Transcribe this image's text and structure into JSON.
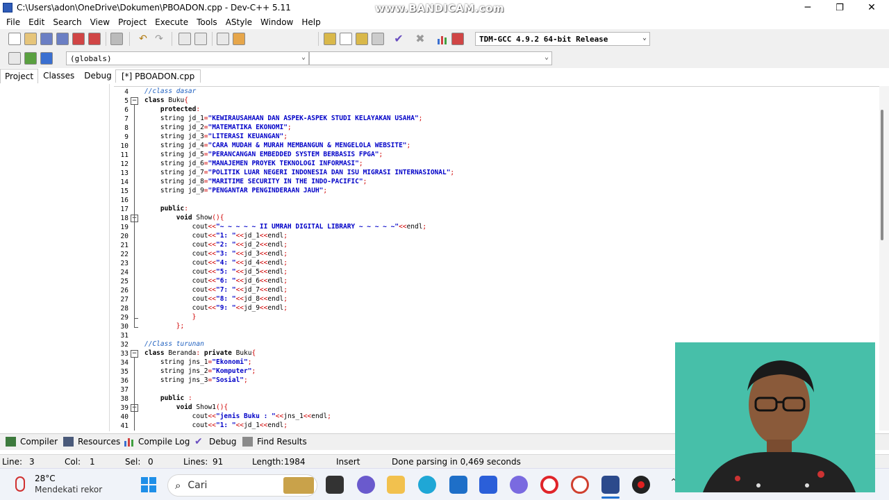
{
  "window": {
    "title": "C:\\Users\\adon\\OneDrive\\Dokumen\\PBOADON.cpp - Dev-C++ 5.11",
    "watermark": "www.BANDICAM.com",
    "min": "─",
    "max": "❐",
    "close": "✕"
  },
  "menu": [
    "File",
    "Edit",
    "Search",
    "View",
    "Project",
    "Execute",
    "Tools",
    "AStyle",
    "Window",
    "Help"
  ],
  "toolbar": {
    "compiler_select": "TDM-GCC 4.9.2 64-bit Release",
    "scope_select": "(globals)",
    "member_select": ""
  },
  "side_tabs": [
    "Project",
    "Classes",
    "Debug"
  ],
  "editor_tab": "[*] PBOADON.cpp",
  "code_lines": [
    {
      "n": "4",
      "html": "<span class='cm'>//class dasar</span>"
    },
    {
      "n": "5",
      "html": "<span class='kw'>class</span> Buku<span class='op'>{</span>",
      "fold": "open"
    },
    {
      "n": "6",
      "html": "    <span class='kw'>protected</span><span class='op'>:</span>"
    },
    {
      "n": "7",
      "html": "    string jd_1<span class='op'>=</span><span class='str'>\"KEWIRAUSAHAAN DAN ASPEK-ASPEK STUDI KELAYAKAN USAHA\"</span><span class='op'>;</span>"
    },
    {
      "n": "8",
      "html": "    string jd_2<span class='op'>=</span><span class='str'>\"MATEMATIKA EKONOMI\"</span><span class='op'>;</span>"
    },
    {
      "n": "9",
      "html": "    string jd_3<span class='op'>=</span><span class='str'>\"LITERASI KEUANGAN\"</span><span class='op'>;</span>"
    },
    {
      "n": "10",
      "html": "    string jd_4<span class='op'>=</span><span class='str'>\"CARA MUDAH &amp; MURAH MEMBANGUN &amp; MENGELOLA WEBSITE\"</span><span class='op'>;</span>"
    },
    {
      "n": "11",
      "html": "    string jd_5<span class='op'>=</span><span class='str'>\"PERANCANGAN EMBEDDED SYSTEM BERBASIS FPGA\"</span><span class='op'>;</span>"
    },
    {
      "n": "12",
      "html": "    string jd_6<span class='op'>=</span><span class='str'>\"MANAJEMEN PROYEK TEKNOLOGI INFORMASI\"</span><span class='op'>;</span>"
    },
    {
      "n": "13",
      "html": "    string jd_7<span class='op'>=</span><span class='str'>\"POLITIK LUAR NEGERI INDONESIA DAN ISU MIGRASI INTERNASIONAL\"</span><span class='op'>;</span>"
    },
    {
      "n": "14",
      "html": "    string jd_8<span class='op'>=</span><span class='str'>\"MARITIME SECURITY IN THE INDO-PACIFIC\"</span><span class='op'>;</span>"
    },
    {
      "n": "15",
      "html": "    string jd_9<span class='op'>=</span><span class='str'>\"PENGANTAR PENGINDERAAN JAUH\"</span><span class='op'>;</span>"
    },
    {
      "n": "16",
      "html": ""
    },
    {
      "n": "17",
      "html": "    <span class='kw'>public</span><span class='op'>:</span>"
    },
    {
      "n": "18",
      "html": "        <span class='kw'>void</span> Show<span class='op'>(){</span>",
      "fold": "open"
    },
    {
      "n": "19",
      "html": "            cout<span class='op'>&lt;&lt;</span><span class='str'>\"~ ~ ~ ~ ~ II UMRAH DIGITAL LIBRARY ~ ~ ~ ~ ~\"</span><span class='op'>&lt;&lt;</span>endl<span class='op'>;</span>"
    },
    {
      "n": "20",
      "html": "            cout<span class='op'>&lt;&lt;</span><span class='str'>\"1: \"</span><span class='op'>&lt;&lt;</span>jd_1<span class='op'>&lt;&lt;</span>endl<span class='op'>;</span>"
    },
    {
      "n": "21",
      "html": "            cout<span class='op'>&lt;&lt;</span><span class='str'>\"2: \"</span><span class='op'>&lt;&lt;</span>jd_2<span class='op'>&lt;&lt;</span>endl<span class='op'>;</span>"
    },
    {
      "n": "22",
      "html": "            cout<span class='op'>&lt;&lt;</span><span class='str'>\"3: \"</span><span class='op'>&lt;&lt;</span>jd_3<span class='op'>&lt;&lt;</span>endl<span class='op'>;</span>"
    },
    {
      "n": "23",
      "html": "            cout<span class='op'>&lt;&lt;</span><span class='str'>\"4: \"</span><span class='op'>&lt;&lt;</span>jd_4<span class='op'>&lt;&lt;</span>endl<span class='op'>;</span>"
    },
    {
      "n": "24",
      "html": "            cout<span class='op'>&lt;&lt;</span><span class='str'>\"5: \"</span><span class='op'>&lt;&lt;</span>jd_5<span class='op'>&lt;&lt;</span>endl<span class='op'>;</span>"
    },
    {
      "n": "25",
      "html": "            cout<span class='op'>&lt;&lt;</span><span class='str'>\"6: \"</span><span class='op'>&lt;&lt;</span>jd_6<span class='op'>&lt;&lt;</span>endl<span class='op'>;</span>"
    },
    {
      "n": "26",
      "html": "            cout<span class='op'>&lt;&lt;</span><span class='str'>\"7: \"</span><span class='op'>&lt;&lt;</span>jd_7<span class='op'>&lt;&lt;</span>endl<span class='op'>;</span>"
    },
    {
      "n": "27",
      "html": "            cout<span class='op'>&lt;&lt;</span><span class='str'>\"8: \"</span><span class='op'>&lt;&lt;</span>jd_8<span class='op'>&lt;&lt;</span>endl<span class='op'>;</span>"
    },
    {
      "n": "28",
      "html": "            cout<span class='op'>&lt;&lt;</span><span class='str'>\"9: \"</span><span class='op'>&lt;&lt;</span>jd_9<span class='op'>&lt;&lt;</span>endl<span class='op'>;</span>"
    },
    {
      "n": "29",
      "html": "            <span class='op'>}</span>",
      "fold": "end"
    },
    {
      "n": "30",
      "html": "        <span class='op'>};</span>",
      "fold": "end"
    },
    {
      "n": "31",
      "html": ""
    },
    {
      "n": "32",
      "html": "<span class='cm'>//Class turunan</span>"
    },
    {
      "n": "33",
      "html": "<span class='kw'>class</span> Beranda<span class='op'>:</span> <span class='kw'>private</span> Buku<span class='op'>{</span>",
      "fold": "open"
    },
    {
      "n": "34",
      "html": "    string jns_1<span class='op'>=</span><span class='str'>\"Ekonomi\"</span><span class='op'>;</span>"
    },
    {
      "n": "35",
      "html": "    string jns_2<span class='op'>=</span><span class='str'>\"Komputer\"</span><span class='op'>;</span>"
    },
    {
      "n": "36",
      "html": "    string jns_3<span class='op'>=</span><span class='str'>\"Sosial\"</span><span class='op'>;</span>"
    },
    {
      "n": "37",
      "html": ""
    },
    {
      "n": "38",
      "html": "    <span class='kw'>public</span> <span class='op'>:</span>"
    },
    {
      "n": "39",
      "html": "        <span class='kw'>void</span> Show1<span class='op'>(){</span>",
      "fold": "open"
    },
    {
      "n": "40",
      "html": "            cout<span class='op'>&lt;&lt;</span><span class='str'>\"jenis Buku : \"</span><span class='op'>&lt;&lt;</span>jns_1<span class='op'>&lt;&lt;</span>endl<span class='op'>;</span>"
    },
    {
      "n": "41",
      "html": "            cout<span class='op'>&lt;&lt;</span><span class='str'>\"1: \"</span><span class='op'>&lt;&lt;</span>jd_1<span class='op'>&lt;&lt;</span>endl<span class='op'>;</span>"
    }
  ],
  "bottom_tabs": [
    "Compiler",
    "Resources",
    "Compile Log",
    "Debug",
    "Find Results"
  ],
  "status": {
    "line_label": "Line:",
    "line": "3",
    "col_label": "Col:",
    "col": "1",
    "sel_label": "Sel:",
    "sel": "0",
    "lines_label": "Lines:",
    "lines": "91",
    "length_label": "Length:",
    "length": "1984",
    "mode": "Insert",
    "message": "Done parsing in 0,469 seconds"
  },
  "taskbar": {
    "temp": "28°C",
    "weather": "Mendekati rekor",
    "search_placeholder": "Cari"
  },
  "colors": {
    "keyword": "#000000",
    "string": "#0000c8",
    "comment": "#1d5fbf",
    "operator": "#d00000",
    "webcam_bg": "#47bfa9"
  }
}
